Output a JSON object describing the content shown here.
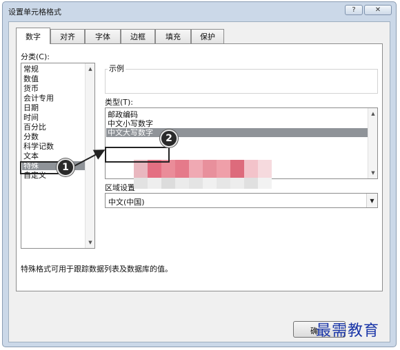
{
  "dialog": {
    "title": "设置单元格格式",
    "help_glyph": "?",
    "close_glyph": "✕"
  },
  "tabs": [
    {
      "label": "数字",
      "active": true
    },
    {
      "label": "对齐",
      "active": false
    },
    {
      "label": "字体",
      "active": false
    },
    {
      "label": "边框",
      "active": false
    },
    {
      "label": "填充",
      "active": false
    },
    {
      "label": "保护",
      "active": false
    }
  ],
  "category": {
    "label": "分类(C):",
    "items": [
      "常规",
      "数值",
      "货币",
      "会计专用",
      "日期",
      "时间",
      "百分比",
      "分数",
      "科学记数",
      "文本",
      "特殊",
      "自定义"
    ],
    "selected": "特殊"
  },
  "sample": {
    "label": "示例",
    "value": ""
  },
  "type": {
    "label": "类型(T):",
    "items": [
      "邮政编码",
      "中文小写数字",
      "中文大写数字"
    ],
    "selected": "中文大写数字"
  },
  "locale": {
    "label": "区域设置",
    "value": "中文(中国)"
  },
  "description": "特殊格式可用于跟踪数据列表及数据库的值。",
  "buttons": {
    "ok_partial": "确"
  },
  "annotations": {
    "badge1": "1",
    "badge2": "2"
  },
  "watermark": "最需教育",
  "colors": {
    "selection": "#8f9398",
    "frame": "#cbd8e8",
    "watermark": "#1a36a8"
  }
}
